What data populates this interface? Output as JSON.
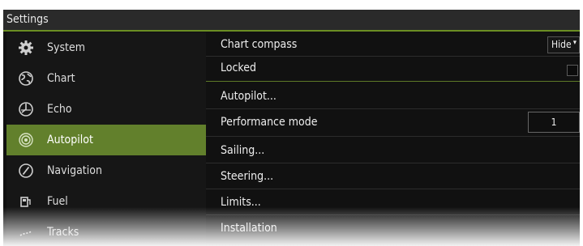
{
  "window": {
    "title": "Settings"
  },
  "sidebar": {
    "items": [
      {
        "label": "System",
        "icon": "gear-icon"
      },
      {
        "label": "Chart",
        "icon": "globe-icon"
      },
      {
        "label": "Echo",
        "icon": "sonar-icon"
      },
      {
        "label": "Autopilot",
        "icon": "autopilot-icon",
        "active": true
      },
      {
        "label": "Navigation",
        "icon": "compass-icon"
      },
      {
        "label": "Fuel",
        "icon": "fuel-pump-icon"
      },
      {
        "label": "Tracks",
        "icon": "tracks-icon"
      }
    ]
  },
  "settings": {
    "chart_compass": {
      "label": "Chart compass",
      "value": "Hide"
    },
    "locked": {
      "label": "Locked",
      "checked": false
    },
    "autopilot": {
      "label": "Autopilot..."
    },
    "performance_mode": {
      "label": "Performance mode",
      "value": "1"
    },
    "sailing": {
      "label": "Sailing..."
    },
    "steering": {
      "label": "Steering..."
    },
    "limits": {
      "label": "Limits..."
    },
    "installation": {
      "label": "Installation"
    }
  },
  "colors": {
    "accent": "#62802c",
    "background": "#111111",
    "titlebar": "#2a2a2a"
  }
}
